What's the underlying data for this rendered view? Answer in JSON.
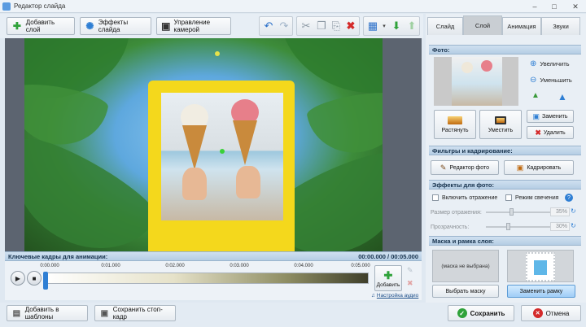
{
  "window": {
    "title": "Редактор слайда"
  },
  "toolbar": {
    "add_layer": "Добавить слой",
    "slide_effects": "Эффекты слайда",
    "camera_control": "Управление камерой"
  },
  "tabs": [
    {
      "label": "Слайд",
      "active": false
    },
    {
      "label": "Слой",
      "active": true
    },
    {
      "label": "Анимация",
      "active": false
    },
    {
      "label": "Звуки",
      "active": false
    }
  ],
  "photo_section": {
    "header": "Фото:",
    "zoom_in": "Увеличить",
    "zoom_out": "Уменьшить",
    "stretch": "Растянуть",
    "fit": "Уместить",
    "replace": "Заменить",
    "delete": "Удалить"
  },
  "filters_section": {
    "header": "Фильтры и кадрирование:",
    "photo_editor": "Редактор фото",
    "crop": "Кадрировать"
  },
  "effects_section": {
    "header": "Эффекты для фото:",
    "reflection": "Включить отражение",
    "glow": "Режим свечения",
    "reflection_size_label": "Размер отражения:",
    "reflection_size_value": "35%",
    "reflection_size_level": 0.35,
    "transparency_label": "Прозрачность:",
    "transparency_value": "30%",
    "transparency_level": 0.3
  },
  "mask_section": {
    "header": "Маска и рамка слоя:",
    "mask_placeholder": "(маска не выбрана)",
    "choose_mask": "Выбрать маску",
    "replace_frame": "Заменить рамку"
  },
  "timeline": {
    "header": "Ключевые кадры для анимации:",
    "time_readout": "00:00.000 / 00:05.000",
    "ticks": [
      "0:00.000",
      "0:01.000",
      "0:02.000",
      "0:03.000",
      "0:04.000",
      "0:05.000"
    ],
    "add_label": "Добавить",
    "audio_settings": "Настройка аудио"
  },
  "bottom": {
    "add_to_templates": "Добавить в шаблоны",
    "save_frame": "Сохранить стоп-кадр",
    "save": "Сохранить",
    "cancel": "Отмена"
  },
  "colors": {
    "accent_green": "#2fa23a",
    "danger_red": "#d42a2a",
    "frame_yellow": "#f4d81c",
    "panel_header": "#b5cde4"
  }
}
